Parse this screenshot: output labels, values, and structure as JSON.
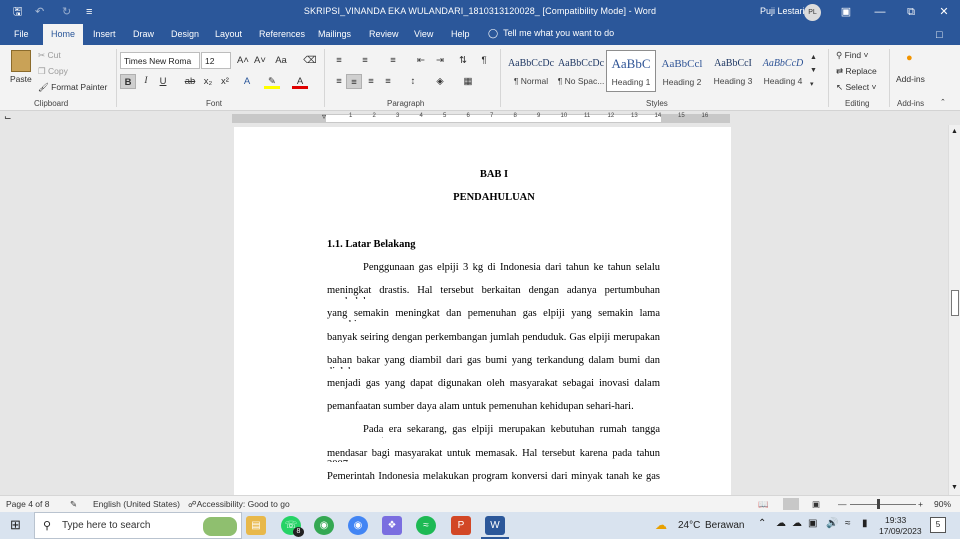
{
  "window": {
    "title": "SKRIPSI_VINANDA EKA WULANDARI_1810313120028_ [Compatibility Mode] - Word",
    "user_name": "Puji Lestari",
    "user_initials": "PL"
  },
  "tabs": [
    "File",
    "Home",
    "Insert",
    "Draw",
    "Design",
    "Layout",
    "References",
    "Mailings",
    "Review",
    "View",
    "Help"
  ],
  "tell_me": "Tell me what you want to do",
  "clipboard": {
    "paste": "Paste",
    "cut": "Cut",
    "copy": "Copy",
    "format_painter": "Format Painter",
    "group": "Clipboard"
  },
  "font": {
    "name": "Times New Roma",
    "size": "12",
    "group": "Font"
  },
  "paragraph": {
    "group": "Paragraph"
  },
  "styles": {
    "group": "Styles",
    "items": [
      {
        "preview": "AaBbCcDc",
        "name": "¶ Normal"
      },
      {
        "preview": "AaBbCcDc",
        "name": "¶ No Spac..."
      },
      {
        "preview": "AaBbC",
        "name": "Heading 1"
      },
      {
        "preview": "AaBbCcl",
        "name": "Heading 2"
      },
      {
        "preview": "AaBbCcI",
        "name": "Heading 3"
      },
      {
        "preview": "AaBbCcD",
        "name": "Heading 4"
      }
    ]
  },
  "editing": {
    "find": "Find",
    "replace": "Replace",
    "select": "Select",
    "group": "Editing"
  },
  "addins": {
    "label": "Add-ins",
    "group": "Add-ins"
  },
  "document": {
    "chapter": "BAB I",
    "chapter_title": "PENDAHULUAN",
    "section": "1.1. Latar Belakang",
    "lines": [
      "Penggunaan gas elpiji 3 kg di Indonesia dari tahun ke tahun selalu",
      "meningkat drastis. Hal tersebut berkaitan dengan adanya pertumbuhan penduduk",
      "yang semakin meningkat dan pemenuhan gas elpiji yang semakin lama semakin",
      "banyak seiring dengan perkembangan jumlah penduduk.  Gas elpiji merupakan",
      "bahan bakar yang diambil dari gas bumi yang terkandung dalam bumi dan diolah",
      "menjadi gas yang dapat digunakan oleh masyarakat sebagai inovasi dalam",
      "pemanfaatan sumber daya alam untuk pemenuhan kehidupan sehari-hari.",
      "Pada era sekarang, gas elpiji merupakan kebutuhan rumah tangga yang",
      "mendasar bagi masyarakat untuk memasak. Hal tersebut karena pada tahun 2007",
      "Pemerintah Indonesia melakukan program konversi dari minyak tanah ke gas"
    ]
  },
  "ruler_labels": [
    "1",
    "2",
    "3",
    "4",
    "5",
    "6",
    "7",
    "8",
    "9",
    "10",
    "11",
    "12",
    "13",
    "14",
    "15",
    "16"
  ],
  "status": {
    "page": "Page 4 of 8",
    "language": "English (United States)",
    "accessibility": "Accessibility: Good to go",
    "zoom": "90%"
  },
  "taskbar": {
    "search_placeholder": "Type here to search",
    "weather_temp": "24°C",
    "weather_text": "Berawan",
    "time": "19:33",
    "date": "17/09/2023",
    "notif_count": "5",
    "whatsapp_badge": "8"
  },
  "colors": {
    "word_blue": "#2b579a",
    "taskbar": "#d9e3ef"
  }
}
